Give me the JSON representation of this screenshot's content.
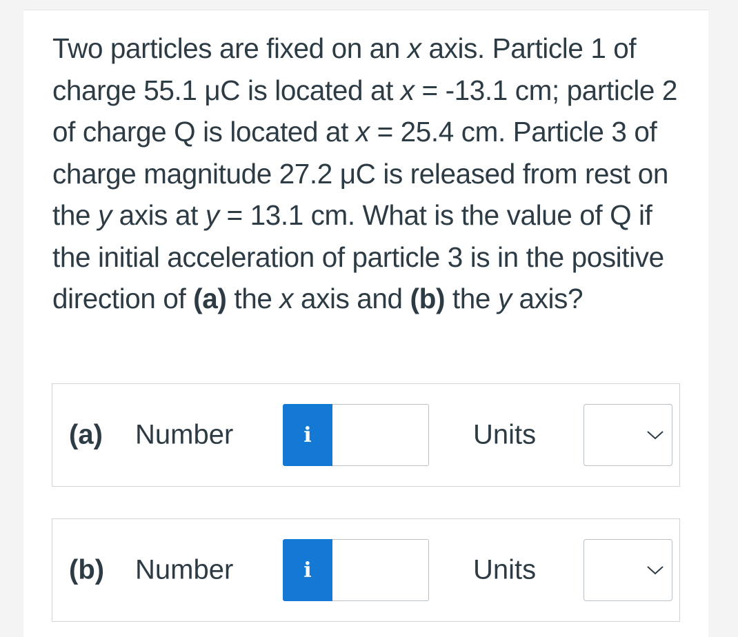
{
  "question": {
    "p1": "Two particles are fixed on an ",
    "v_x1": "x",
    "p2": " axis. Particle 1 of charge 55.1 μC is located at ",
    "v_x2": "x",
    "p3": " = -13.1 cm; particle 2 of charge Q is located at ",
    "v_x3": "x",
    "p4": " = 25.4 cm. Particle 3 of charge magnitude 27.2 μC is released from rest on the ",
    "v_y1": "y",
    "p5": " axis at ",
    "v_y2": "y",
    "p6": " = 13.1 cm. What is the value of Q if the initial acceleration of particle 3 is in the positive direction of ",
    "b_a": "(a)",
    "p7": " the ",
    "v_x4": "x",
    "p8": " axis and ",
    "b_b": "(b)",
    "p9": " the ",
    "v_y3": "y",
    "p10": " axis?"
  },
  "answers": [
    {
      "part_label": "(a)",
      "number_label": "Number",
      "info_icon": "i",
      "number_value": "",
      "units_label": "Units",
      "units_value": ""
    },
    {
      "part_label": "(b)",
      "number_label": "Number",
      "info_icon": "i",
      "number_value": "",
      "units_label": "Units",
      "units_value": ""
    }
  ],
  "colors": {
    "info_button": "#1379d4",
    "text": "#2d3b45",
    "border": "#cfd4d8"
  },
  "icons": {
    "info": "info-icon",
    "dropdown": "chevron-down-icon"
  }
}
